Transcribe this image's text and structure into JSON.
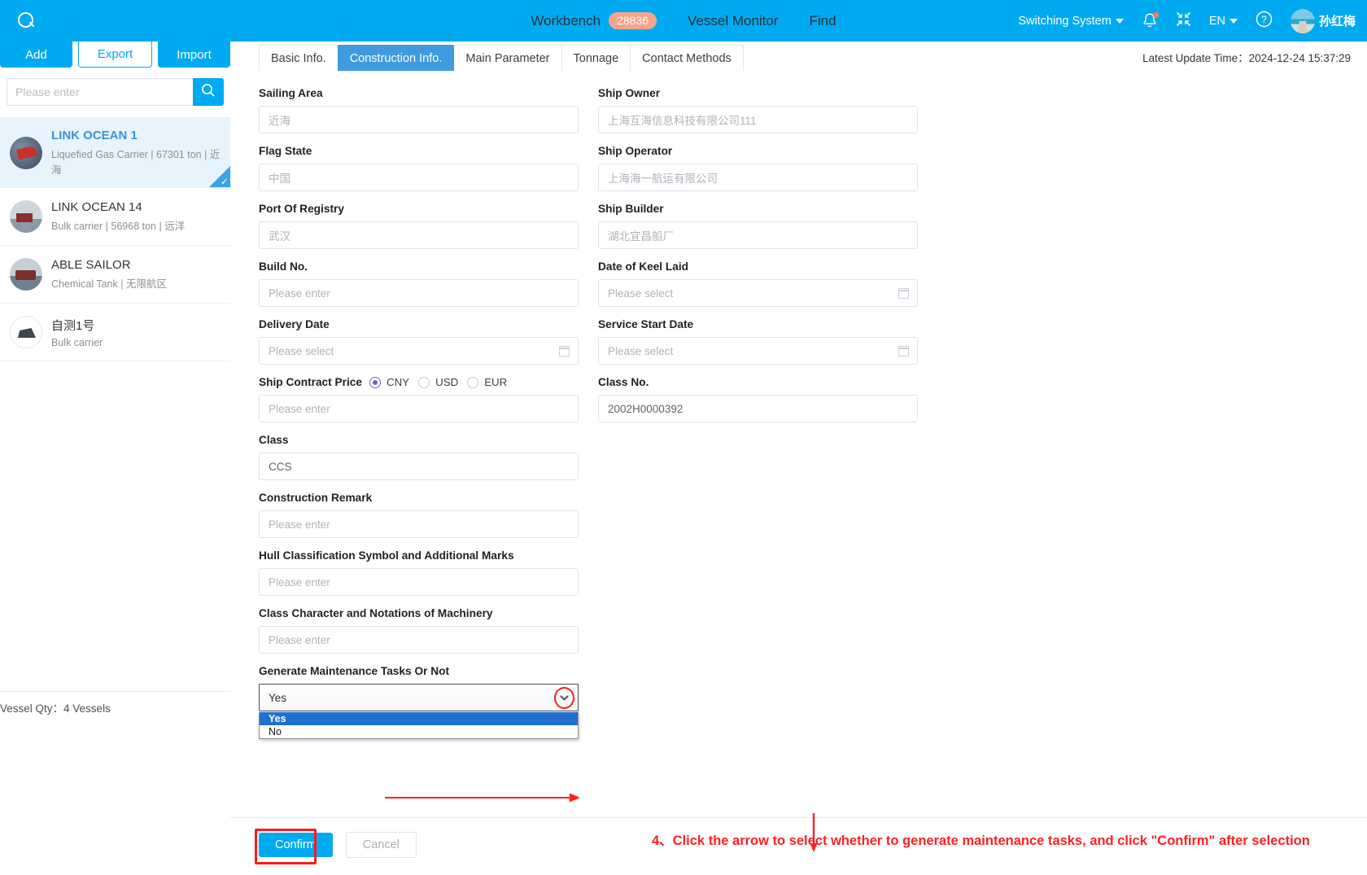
{
  "topnav": {
    "search_icon": "search-icon",
    "items": [
      {
        "label": "Workbench",
        "badge": "28836"
      },
      {
        "label": "Vessel Monitor",
        "badge": ""
      },
      {
        "label": "Find",
        "badge": ""
      }
    ],
    "switching_system": "Switching System",
    "bell_icon": "bell-icon",
    "collapse_icon": "collapse-icon",
    "language": "EN",
    "help_icon": "help-icon",
    "user_name": "孙红梅"
  },
  "sidebar": {
    "buttons": {
      "add": "Add",
      "export": "Export",
      "import": "Import"
    },
    "search_placeholder": "Please enter",
    "vessels": [
      {
        "name": "LINK OCEAN 1",
        "sub": "Liquefied Gas Carrier | 67301 ton | 近海",
        "selected": true
      },
      {
        "name": "LINK OCEAN 14",
        "sub": "Bulk carrier | 56968 ton | 远洋",
        "selected": false
      },
      {
        "name": "ABLE SAILOR",
        "sub": "Chemical Tank | 无限航区",
        "selected": false
      },
      {
        "name": "自测1号",
        "sub": "Bulk carrier",
        "selected": false
      }
    ],
    "vessel_qty_label": "Vessel Qty：",
    "vessel_qty_value": "4 Vessels"
  },
  "main": {
    "tabs": [
      {
        "label": "Basic Info.",
        "active": false
      },
      {
        "label": "Construction Info.",
        "active": true
      },
      {
        "label": "Main Parameter",
        "active": false
      },
      {
        "label": "Tonnage",
        "active": false
      },
      {
        "label": "Contact Methods",
        "active": false
      }
    ],
    "update_time_label": "Latest Update Time：",
    "update_time_value": "2024-12-24 15:37:29",
    "left_fields": [
      {
        "label": "Sailing Area",
        "value": "近海",
        "filled": false,
        "type": "text"
      },
      {
        "label": "Flag State",
        "value": "中国",
        "filled": false,
        "type": "text"
      },
      {
        "label": "Port Of Registry",
        "value": "武汉",
        "filled": false,
        "type": "text"
      },
      {
        "label": "Build No.",
        "value": "Please enter",
        "filled": false,
        "type": "text"
      },
      {
        "label": "Delivery Date",
        "value": "Please select",
        "filled": false,
        "type": "date"
      }
    ],
    "right_fields": [
      {
        "label": "Ship Owner",
        "value": "上海互海信息科技有限公司111",
        "filled": false,
        "type": "text"
      },
      {
        "label": "Ship Operator",
        "value": "上海海一航运有限公司",
        "filled": false,
        "type": "text"
      },
      {
        "label": "Ship Builder",
        "value": "湖北宜昌船厂",
        "filled": false,
        "type": "text"
      },
      {
        "label": "Date of Keel Laid",
        "value": "Please select",
        "filled": false,
        "type": "date"
      },
      {
        "label": "Service Start Date",
        "value": "Please select",
        "filled": false,
        "type": "date"
      }
    ],
    "contract_price": {
      "label": "Ship Contract Price",
      "currencies": [
        {
          "label": "CNY",
          "checked": true
        },
        {
          "label": "USD",
          "checked": false
        },
        {
          "label": "EUR",
          "checked": false
        }
      ],
      "value": "Please enter"
    },
    "class_no": {
      "label": "Class No.",
      "value": "2002H0000392"
    },
    "left_fields_2": [
      {
        "label": "Class",
        "value": "CCS",
        "filled": true
      },
      {
        "label": "Construction Remark",
        "value": "Please enter",
        "filled": false
      },
      {
        "label": "Hull Classification Symbol and Additional Marks",
        "value": "Please enter",
        "filled": false
      },
      {
        "label": "Class Character and Notations of Machinery",
        "value": "Please enter",
        "filled": false
      }
    ],
    "generate_tasks": {
      "label": "Generate Maintenance Tasks Or Not",
      "value": "Yes",
      "options": [
        {
          "label": "Yes",
          "selected": true
        },
        {
          "label": "No",
          "selected": false
        }
      ]
    },
    "footer": {
      "confirm": "Confirm",
      "cancel": "Cancel"
    },
    "annotation": "4、Click the arrow to select whether to generate maintenance tasks, and click \"Confirm\" after selection"
  },
  "colors": {
    "brand_blue": "#00AAF0",
    "tab_active": "#3f9ae0",
    "annotation_red": "#FF2020",
    "radio_purple": "#7B5AD9",
    "option_highlight": "#1f6fd0"
  }
}
